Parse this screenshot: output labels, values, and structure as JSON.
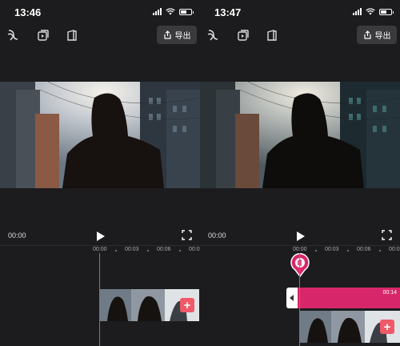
{
  "left": {
    "status_time": "13:46",
    "export_label": "导出",
    "current_time": "00:00",
    "ruler_labels": [
      "00:00",
      "00:03",
      "00:06",
      "00:0"
    ]
  },
  "right": {
    "status_time": "13:47",
    "export_label": "导出",
    "current_time": "00:00",
    "ruler_labels": [
      "00:00",
      "00:03",
      "00:06",
      "00:0"
    ],
    "audio_clip_duration": "00:14"
  },
  "colors": {
    "background": "#1c1c1e",
    "accent_playhead": "#e24b5d",
    "audio_clip": "#d7276a",
    "add_button": "#ef5968"
  },
  "icons": [
    "magic-wand-icon",
    "add-clip-icon",
    "templates-icon",
    "export-icon",
    "play-icon",
    "fullscreen-icon",
    "add-icon",
    "audio-marker-icon"
  ]
}
